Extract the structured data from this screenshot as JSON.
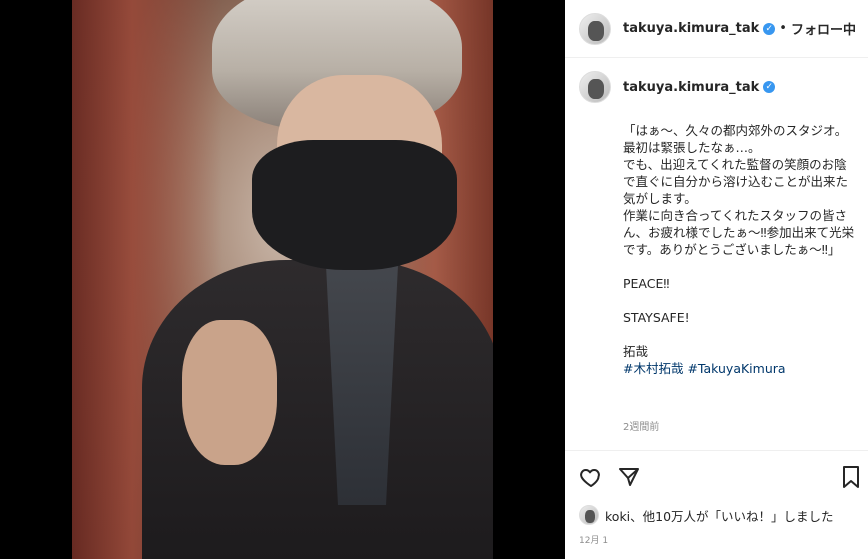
{
  "post": {
    "username": "takuya.kimura_tak",
    "follow_status": "フォロー中",
    "separator": "•",
    "caption": "「はぁ〜、久々の都内郊外のスタジオ。\n最初は緊張したなぁ…。\nでも、出迎えてくれた監督の笑顔のお陰で直ぐに自分から溶け込むことが出来た気がします。\n作業に向き合ってくれたスタッフの皆さん、お疲れ様でしたぁ〜‼参加出来て光栄です。ありがとうございましたぁ〜‼」\n\nPEACE‼\n\nSTAYSAFE!\n\n拓哉",
    "hashtags": "#木村拓哉 #TakuyaKimura",
    "time_ago": "2週間前",
    "likes_text": "koki、他10万人が「いいね！」しました",
    "date": "12月 1"
  },
  "icons": {
    "verified": "verified-badge-icon",
    "like": "heart-icon",
    "share": "paper-plane-icon",
    "save": "bookmark-icon"
  },
  "colors": {
    "verified": "#3897f0",
    "hashtag": "#00376b",
    "muted": "#8e8e8e"
  }
}
